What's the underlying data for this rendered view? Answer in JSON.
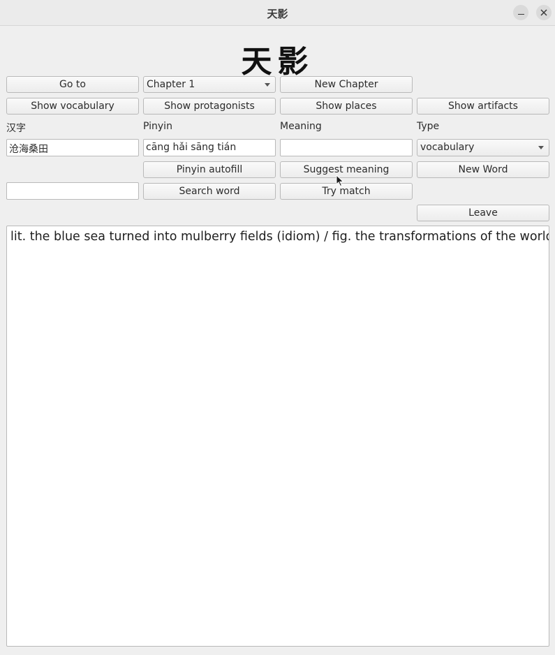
{
  "window": {
    "title": "天影"
  },
  "header": {
    "logo_text": "天影"
  },
  "toolbar": {
    "goto_label": "Go to",
    "chapter_selected": "Chapter 1",
    "new_chapter_label": "New Chapter",
    "show_vocabulary_label": "Show vocabulary",
    "show_protagonists_label": "Show protagonists",
    "show_places_label": "Show places",
    "show_artifacts_label": "Show artifacts"
  },
  "form": {
    "hanzi_label": "汉字",
    "pinyin_label": "Pinyin",
    "meaning_label": "Meaning",
    "type_label": "Type",
    "hanzi_value": "沧海桑田",
    "pinyin_value": "cāng hǎi sāng tián",
    "meaning_value": "",
    "type_selected": "vocabulary",
    "search_value": ""
  },
  "actions": {
    "pinyin_autofill_label": "Pinyin autofill",
    "suggest_meaning_label": "Suggest meaning",
    "new_word_label": "New Word",
    "search_word_label": "Search word",
    "try_match_label": "Try match",
    "leave_label": "Leave"
  },
  "output": {
    "text": "lit. the blue sea turned into mulberry fields (idiom) / fig. the transformations of the world"
  },
  "icons": {
    "minimize": "minimize-icon",
    "close": "close-icon",
    "dropdown": "chevron-down-icon",
    "cursor": "mouse-pointer-icon"
  }
}
